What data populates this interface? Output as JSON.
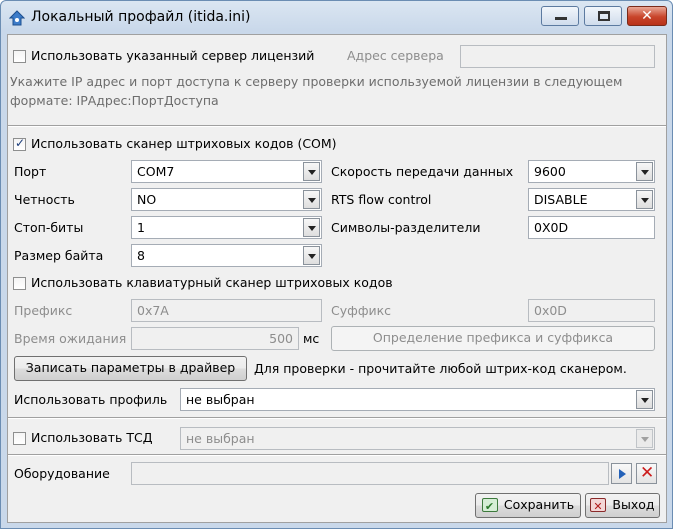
{
  "window": {
    "title": "Локальный профайл (itida.ini)",
    "minimize_glyph": "",
    "maximize_glyph": "",
    "close_glyph": "✕"
  },
  "license": {
    "checkbox_label": "Использовать указанный сервер лицензий",
    "checked": false,
    "server_address_label": "Адрес сервера",
    "server_address_value": "",
    "hint": "Укажите IP адрес и порт доступа к серверу проверки используемой лицензии в следующем формате: IPАдрес:ПортДоступа"
  },
  "scanner": {
    "checkbox_label": "Использовать сканер штриховых кодов (COM)",
    "checked": true,
    "port_label": "Порт",
    "port_value": "COM7",
    "parity_label": "Четность",
    "parity_value": "NO",
    "stopbits_label": "Стоп-биты",
    "stopbits_value": "1",
    "bytesize_label": "Размер байта",
    "bytesize_value": "8",
    "baud_label": "Скорость передачи данных",
    "baud_value": "9600",
    "rts_label": "RTS flow control",
    "rts_value": "DISABLE",
    "delimiters_label": "Символы-разделители",
    "delimiters_value": "0X0D"
  },
  "keyboard_scanner": {
    "checkbox_label": "Использовать клавиатурный сканер штриховых кодов",
    "checked": false,
    "prefix_label": "Префикс",
    "prefix_value": "0x7A",
    "suffix_label": "Суффикс",
    "suffix_value": "0x0D",
    "timeout_label": "Время ожидания",
    "timeout_value": "500",
    "timeout_unit": "мс",
    "detect_button": "Определение префикса и суффикса"
  },
  "driver": {
    "write_button": "Записать параметры в драйвер",
    "check_hint": "Для проверки - прочитайте любой штрих-код сканером."
  },
  "profile": {
    "label": "Использовать профиль",
    "value": "не выбран"
  },
  "tsd": {
    "checkbox_label": "Использовать ТСД",
    "checked": false,
    "value": "не выбран"
  },
  "equipment": {
    "label": "Оборудование",
    "value": ""
  },
  "footer": {
    "save_button": "Сохранить",
    "exit_button": "Выход"
  },
  "icons": {
    "save": "✔",
    "exit": "✕",
    "check": "✓"
  }
}
